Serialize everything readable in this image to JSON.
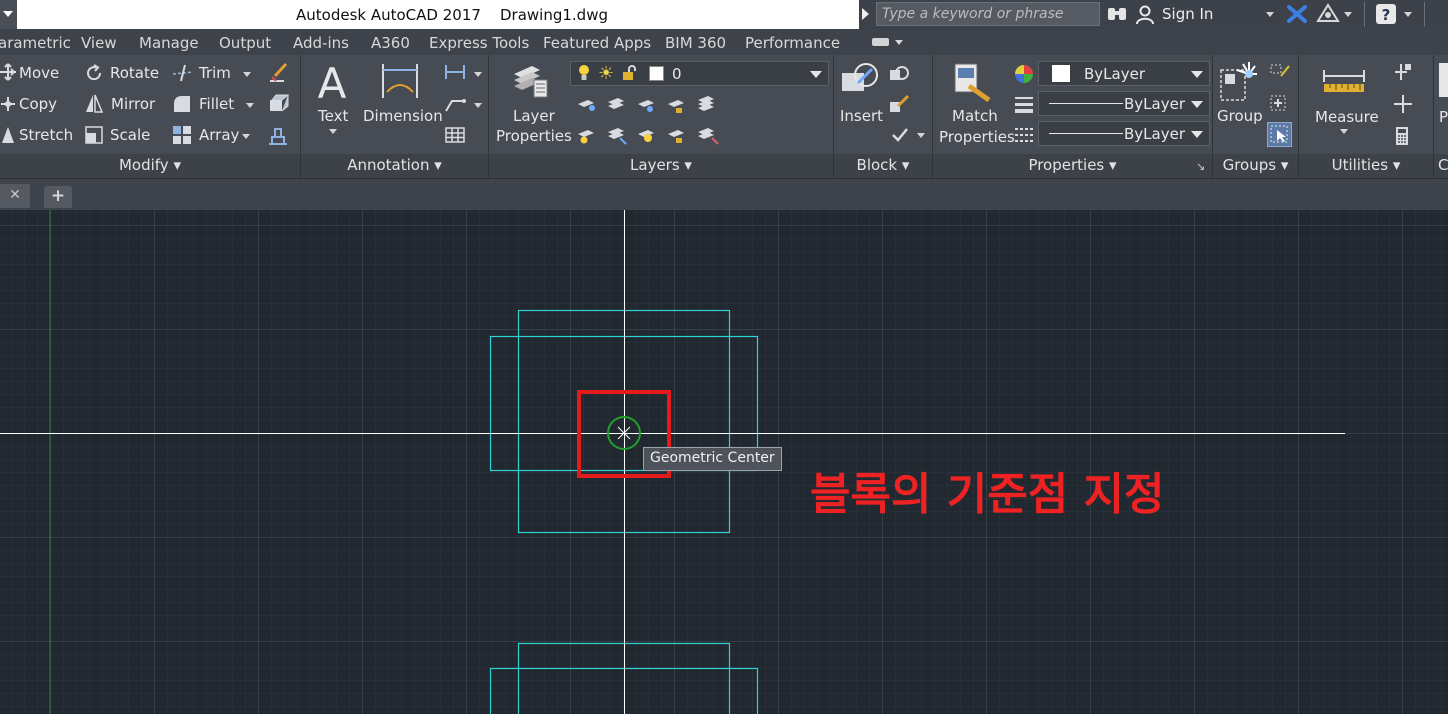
{
  "title_bar": {
    "app_title": "Autodesk AutoCAD 2017",
    "file_name": "Drawing1.dwg",
    "search_placeholder": "Type a keyword or phrase",
    "sign_in_label": "Sign In"
  },
  "ribbon_tabs": [
    "arametric",
    "View",
    "Manage",
    "Output",
    "Add-ins",
    "A360",
    "Express Tools",
    "Featured Apps",
    "BIM 360",
    "Performance"
  ],
  "panels": {
    "modify": {
      "label": "Modify",
      "tools": [
        "Move",
        "Rotate",
        "Trim",
        "Copy",
        "Mirror",
        "Fillet",
        "Stretch",
        "Scale",
        "Array"
      ]
    },
    "annotation": {
      "label": "Annotation",
      "tools": [
        "Text",
        "Dimension"
      ]
    },
    "layers": {
      "label": "Layers",
      "tool_line1": "Layer",
      "tool_line2": "Properties",
      "current_layer": "0"
    },
    "block": {
      "label": "Block",
      "tool": "Insert"
    },
    "properties": {
      "label": "Properties",
      "tool_line1": "Match",
      "tool_line2": "Properties",
      "color": "ByLayer",
      "linetype": "ByLayer",
      "lineweight": "ByLayer"
    },
    "groups": {
      "label": "Groups",
      "tool": "Group"
    },
    "utilities": {
      "label": "Utilities",
      "tool": "Measure"
    },
    "clipped": {
      "label": "C",
      "tool": "P"
    }
  },
  "canvas": {
    "tooltip": "Geometric Center",
    "annotation": "블록의 기준점 지정",
    "colors": {
      "background": "#212830",
      "geometry": "#2ed3d3",
      "crosshair": "#ffffff",
      "highlight": "#e31b1b",
      "center_circle": "#1fa02a",
      "y_axis": "#2a7a3a"
    }
  }
}
